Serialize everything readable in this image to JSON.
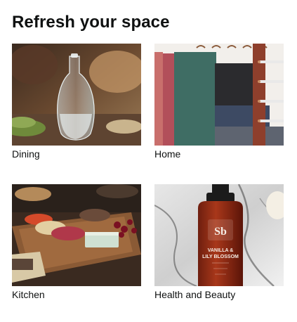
{
  "card": {
    "title": "Refresh your space"
  },
  "tiles": [
    {
      "label": "Dining",
      "image_alt": "Glass carafe of water on a dining table"
    },
    {
      "label": "Home",
      "image_alt": "Folded pants hanging on a pant hanger"
    },
    {
      "label": "Kitchen",
      "image_alt": "Charcuterie board with cheese and berries"
    },
    {
      "label": "Health and Beauty",
      "image_alt": "Vanilla & Lily Blossom body wash bottle on marble"
    }
  ],
  "product_label": {
    "brand_mark": "Sb",
    "line1": "VANILLA &",
    "line2": "LILY BLOSSOM"
  }
}
